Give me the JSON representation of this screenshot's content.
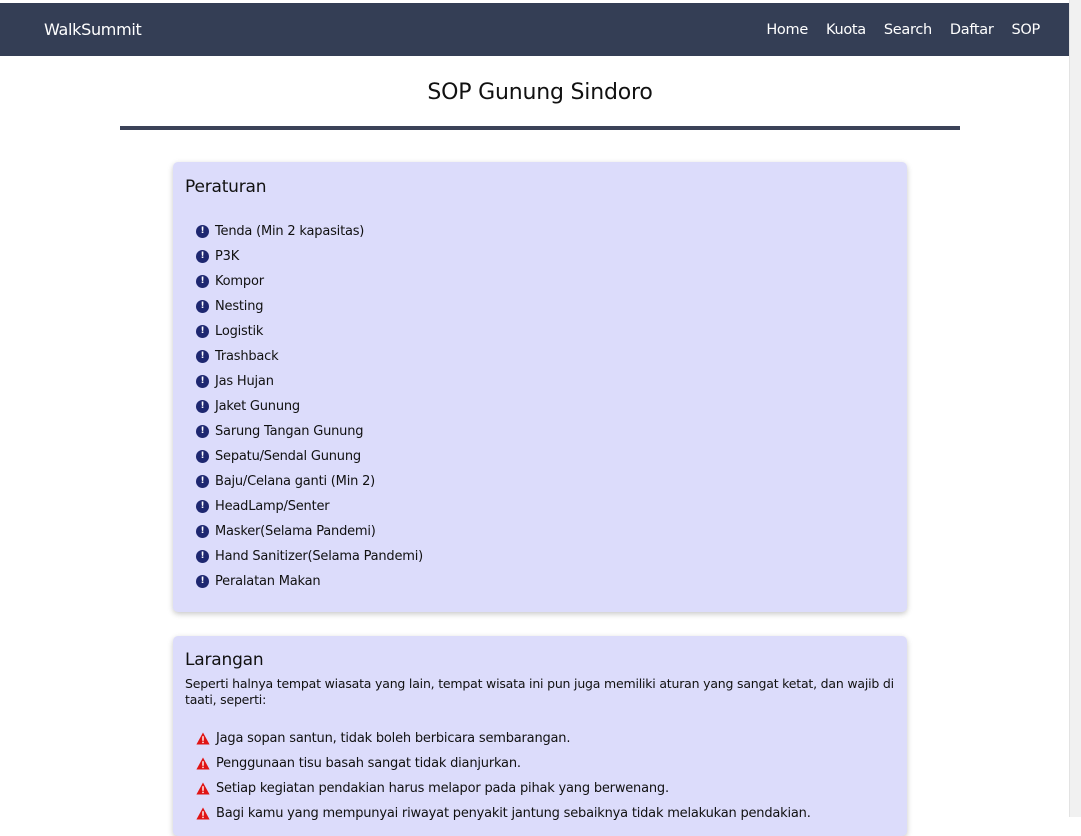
{
  "navbar": {
    "brand": "WalkSummit",
    "links": [
      "Home",
      "Kuota",
      "Search",
      "Daftar",
      "SOP"
    ]
  },
  "page": {
    "title": "SOP Gunung Sindoro"
  },
  "peraturan": {
    "heading": "Peraturan",
    "icon": "exclamation-circle-icon",
    "icon_color": "#1e2770",
    "items": [
      "Tenda (Min 2 kapasitas)",
      "P3K",
      "Kompor",
      "Nesting",
      "Logistik",
      "Trashback",
      "Jas Hujan",
      "Jaket Gunung",
      "Sarung Tangan Gunung",
      "Sepatu/Sendal Gunung",
      "Baju/Celana ganti (Min 2)",
      "HeadLamp/Senter",
      "Masker(Selama Pandemi)",
      "Hand Sanitizer(Selama Pandemi)",
      "Peralatan Makan"
    ]
  },
  "larangan": {
    "heading": "Larangan",
    "intro": "Seperti halnya tempat wiasata yang lain, tempat wisata ini pun juga memiliki aturan yang sangat ketat, dan wajib di taati, seperti:",
    "icon": "warning-triangle-icon",
    "icon_color": "#e01414",
    "items": [
      "Jaga sopan santun, tidak boleh berbicara sembarangan.",
      "Penggunaan tisu basah sangat tidak dianjurkan.",
      "Setiap kegiatan pendakian harus melapor pada pihak yang berwenang.",
      "Bagi kamu yang mempunyai riwayat penyakit jantung sebaiknya tidak melakukan pendakian."
    ]
  },
  "colors": {
    "navbar_bg": "#343e55",
    "card_bg": "#dcdcfb",
    "rule": "#3b4258"
  }
}
